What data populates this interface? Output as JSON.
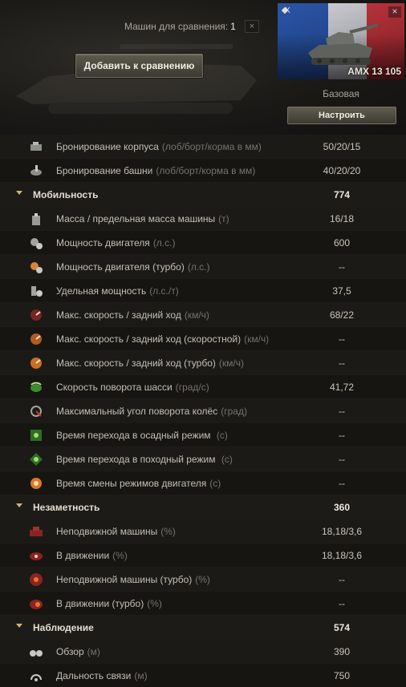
{
  "header": {
    "compare_label": "Машин для сравнения:",
    "compare_count": "1",
    "close_symbol": "×",
    "add_button": "Добавить к сравнению"
  },
  "vehicle": {
    "tier": "X",
    "name": "AMX 13 105",
    "close_symbol": "×",
    "config": "Базовая",
    "config_button": "Настроить",
    "flag_colors": [
      "#2a55a8",
      "#c9c9cf",
      "#b8323a"
    ]
  },
  "rows": [
    {
      "type": "param",
      "icon": "hull-armor-icon",
      "label": "Бронирование корпуса",
      "unit": "(лоб/борт/корма в мм)",
      "value": "50/20/15"
    },
    {
      "type": "param",
      "icon": "turret-armor-icon",
      "label": "Бронирование башни",
      "unit": "(лоб/борт/корма в мм)",
      "value": "40/20/20"
    },
    {
      "type": "section",
      "label": "Мобильность",
      "value": "774"
    },
    {
      "type": "param",
      "icon": "weight-icon",
      "label": "Масса / предельная масса машины",
      "unit": "(т)",
      "value": "16/18"
    },
    {
      "type": "param",
      "icon": "engine-power-icon",
      "label": "Мощность двигателя",
      "unit": "(л.с.)",
      "value": "600"
    },
    {
      "type": "param",
      "icon": "engine-power-turbo-icon",
      "label": "Мощность двигателя (турбо)",
      "unit": "(л.с.)",
      "value": "--"
    },
    {
      "type": "param",
      "icon": "specific-power-icon",
      "label": "Удельная мощность",
      "unit": "(л.с./т)",
      "value": "37,5"
    },
    {
      "type": "param",
      "icon": "speed-limits-icon",
      "label": "Макс. скорость / задний ход",
      "unit": "(км/ч)",
      "value": "68/22"
    },
    {
      "type": "param",
      "icon": "speed-fast-mode-icon",
      "label": "Макс. скорость / задний ход (скоростной)",
      "unit": "(км/ч)",
      "value": "--"
    },
    {
      "type": "param",
      "icon": "speed-turbo-icon",
      "label": "Макс. скорость / задний ход (турбо)",
      "unit": "(км/ч)",
      "value": "--"
    },
    {
      "type": "param",
      "icon": "chassis-rotation-icon",
      "label": "Скорость поворота шасси",
      "unit": "(град/с)",
      "value": "41,72"
    },
    {
      "type": "param",
      "icon": "wheel-angle-icon",
      "label": "Максимальный угол поворота колёс",
      "unit": "(град)",
      "value": "--"
    },
    {
      "type": "param",
      "icon": "siege-mode-icon",
      "label": "Время перехода в осадный режим ",
      "unit": "(с)",
      "value": "--"
    },
    {
      "type": "param",
      "icon": "travel-mode-icon",
      "label": "Время перехода в походный режим ",
      "unit": "(с)",
      "value": "--"
    },
    {
      "type": "param",
      "icon": "engine-mode-switch-icon",
      "label": "Время смены режимов двигателя",
      "unit": "(с)",
      "value": "--"
    },
    {
      "type": "section",
      "label": "Незаметность",
      "value": "360"
    },
    {
      "type": "param",
      "icon": "camo-still-icon",
      "label": "Неподвижной машины",
      "unit": "(%)",
      "value": "18,18/3,6"
    },
    {
      "type": "param",
      "icon": "camo-moving-icon",
      "label": "В движении",
      "unit": "(%)",
      "value": "18,18/3,6"
    },
    {
      "type": "param",
      "icon": "camo-still-turbo-icon",
      "label": "Неподвижной машины (турбо)",
      "unit": "(%)",
      "value": "--"
    },
    {
      "type": "param",
      "icon": "camo-moving-turbo-icon",
      "label": "В движении (турбо)",
      "unit": "(%)",
      "value": "--"
    },
    {
      "type": "section",
      "label": "Наблюдение",
      "value": "574"
    },
    {
      "type": "param",
      "icon": "view-range-icon",
      "label": "Обзор",
      "unit": "(м)",
      "value": "390"
    },
    {
      "type": "param",
      "icon": "radio-range-icon",
      "label": "Дальность связи",
      "unit": "(м)",
      "value": "750"
    }
  ]
}
